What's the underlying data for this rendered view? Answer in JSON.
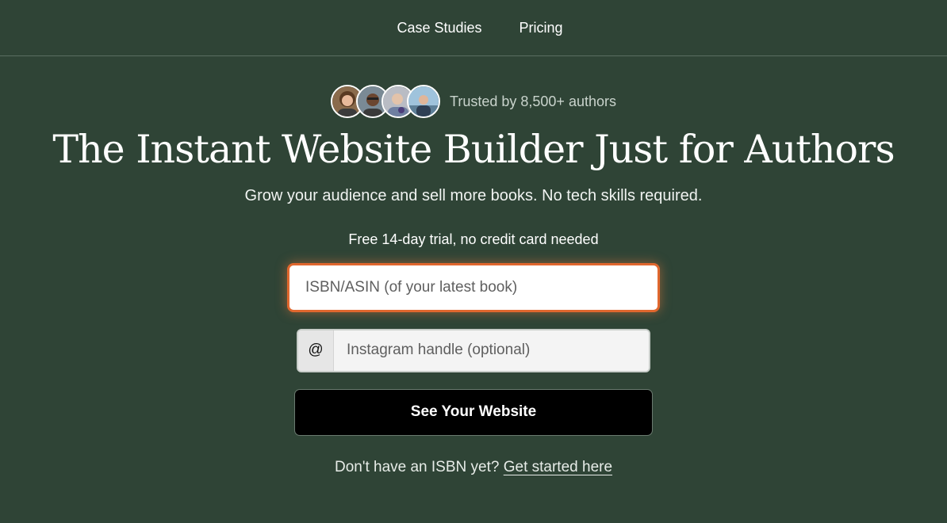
{
  "nav": {
    "links": [
      "Case Studies",
      "Pricing"
    ]
  },
  "trust": {
    "text": "Trusted by 8,500+ authors"
  },
  "hero": {
    "headline": "The Instant Website Builder Just for Authors",
    "subhead": "Grow your audience and sell more books. No tech skills required."
  },
  "form": {
    "trial_note": "Free 14-day trial, no credit card needed",
    "isbn_placeholder": "ISBN/ASIN (of your latest book)",
    "isbn_value": "",
    "instagram_prefix": "@",
    "instagram_placeholder": "Instagram handle (optional)",
    "instagram_value": "",
    "submit_label": "See Your Website"
  },
  "footer_note": {
    "text": "Don't have an ISBN yet?",
    "link_label": "Get started here"
  },
  "colors": {
    "background": "#2f4436",
    "focus_border": "#e0672e",
    "button": "#000000"
  }
}
